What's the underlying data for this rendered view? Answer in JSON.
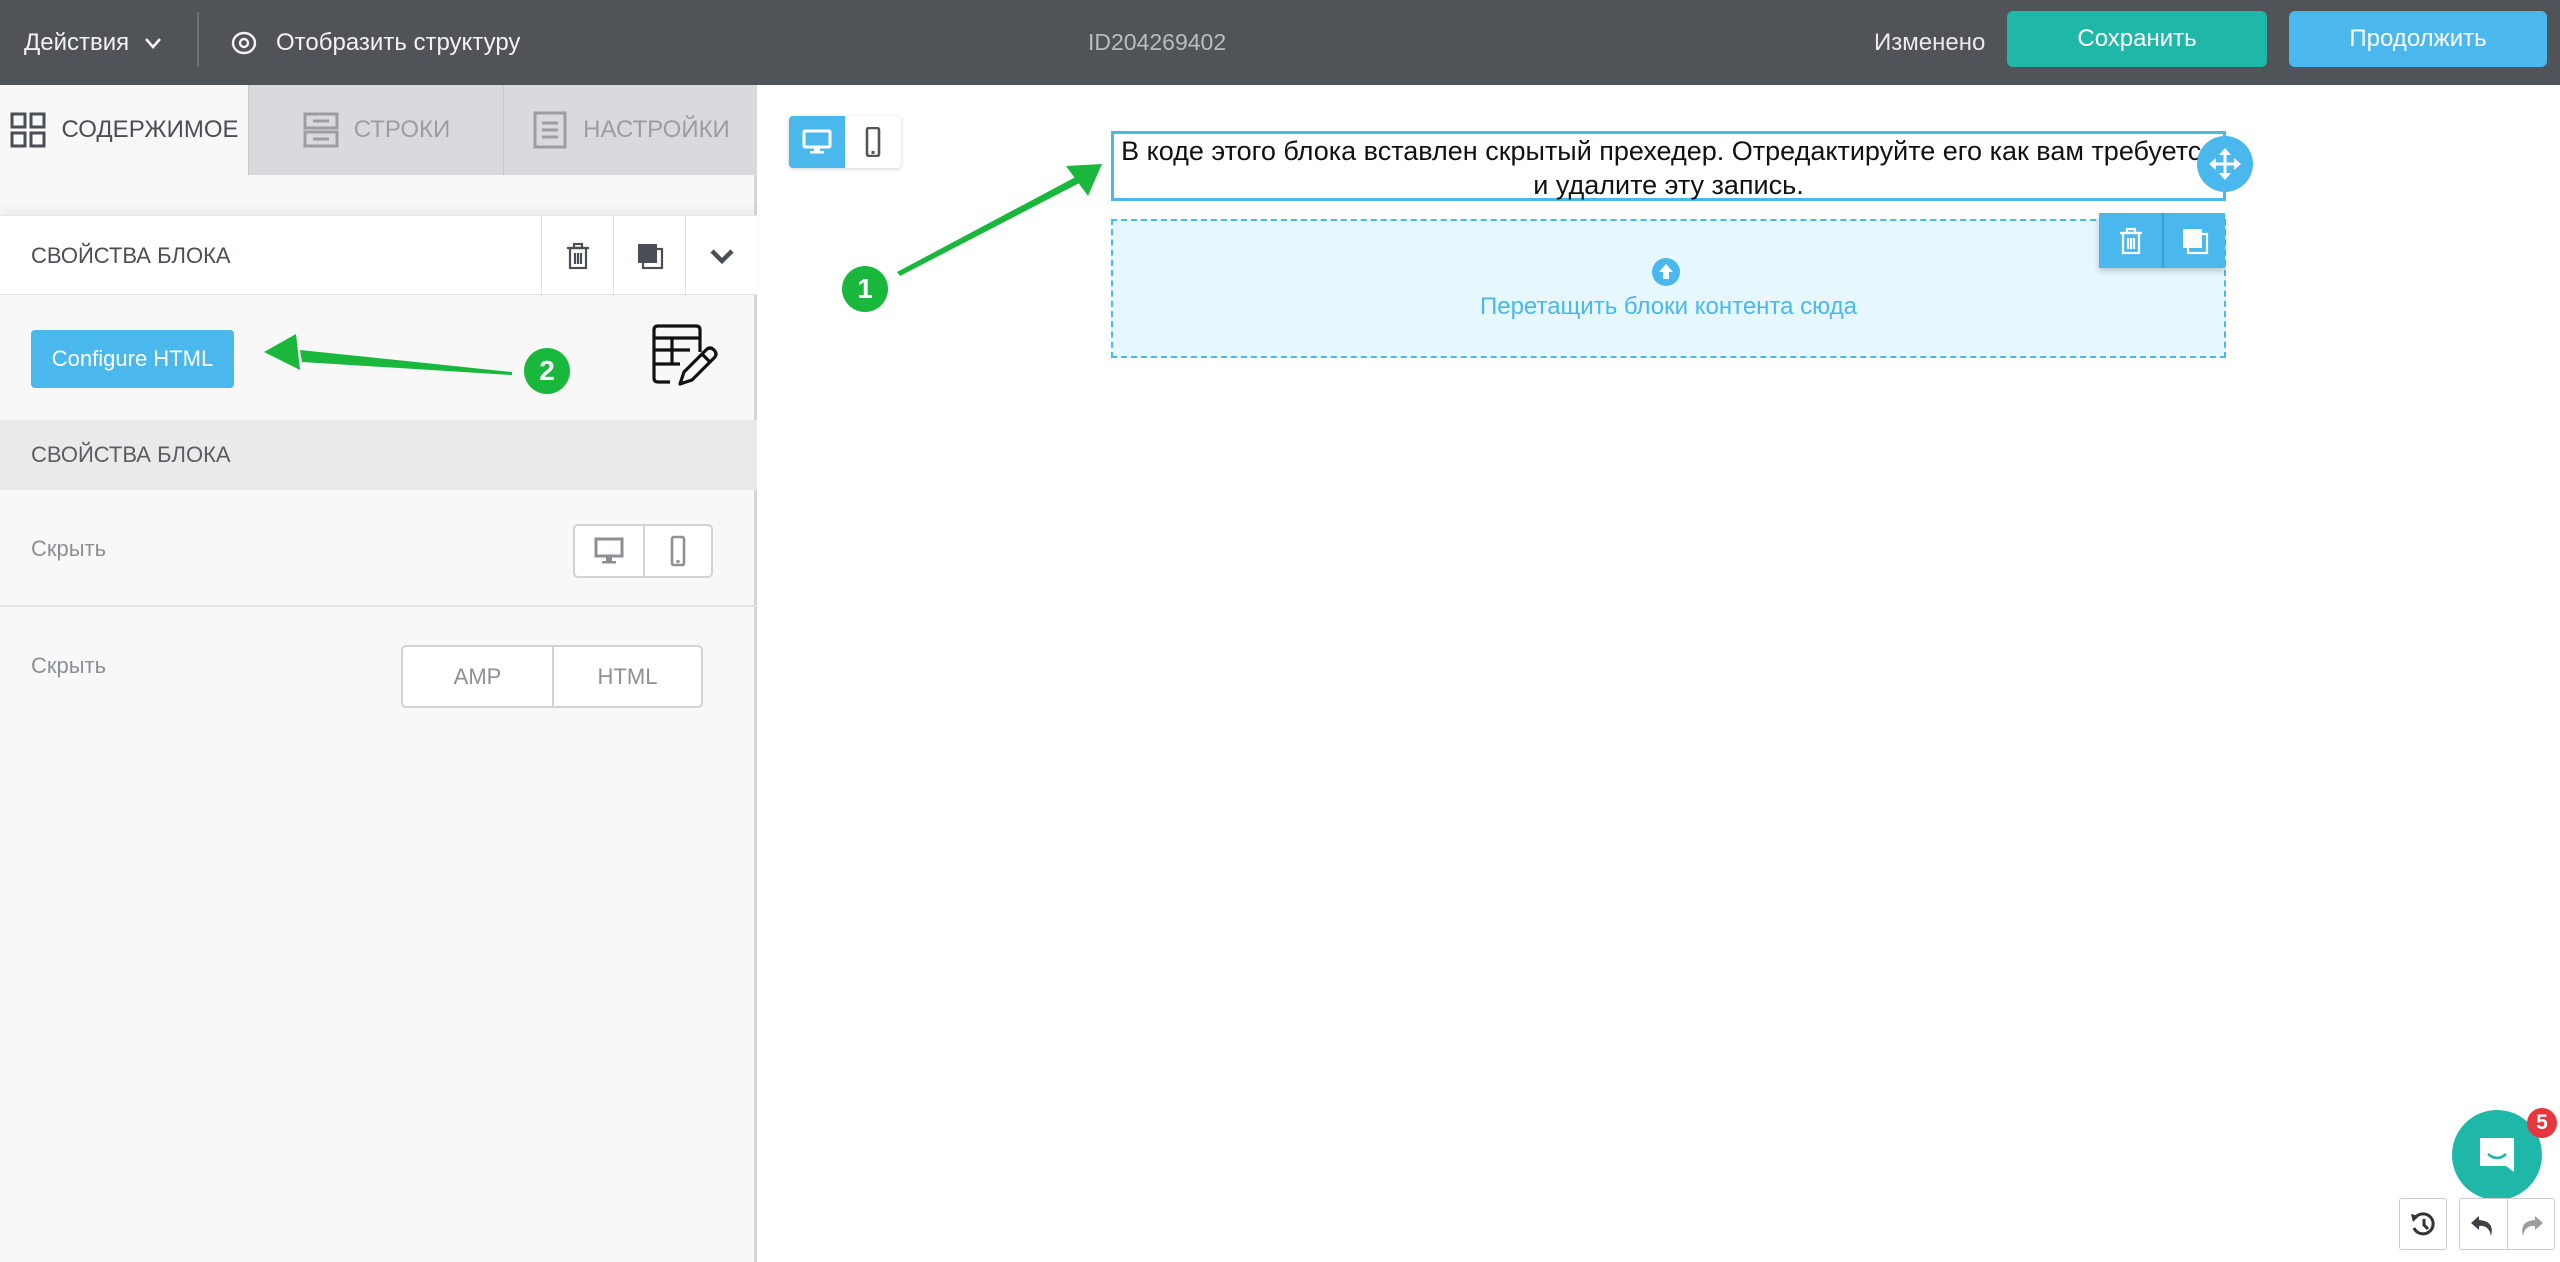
{
  "topbar": {
    "actions_label": "Действия",
    "structure_label": "Отобразить структуру",
    "document_id": "ID204269402",
    "status": "Изменено",
    "save_label": "Сохранить",
    "continue_label": "Продолжить"
  },
  "sidebar": {
    "tabs": [
      {
        "label": "СОДЕРЖИМОЕ",
        "icon": "grid-icon",
        "active": true
      },
      {
        "label": "СТРОКИ",
        "icon": "rows-icon",
        "active": false
      },
      {
        "label": "НАСТРОЙКИ",
        "icon": "settings-doc-icon",
        "active": false
      }
    ],
    "panel_title": "СВОЙСТВА БЛОКА",
    "configure_label": "Configure HTML",
    "section_title": "СВОЙСТВА БЛОКА",
    "hide_device": {
      "label": "Скрыть",
      "options": [
        "desktop-icon",
        "mobile-icon"
      ]
    },
    "hide_format": {
      "label": "Скрыть",
      "options": [
        "AMP",
        "HTML"
      ]
    }
  },
  "canvas": {
    "device_toggle": {
      "active": "desktop"
    },
    "text_block": "В коде этого блока вставлен скрытый прехедер. Отредактируйте его как вам требуется и удалите эту запись.",
    "drop_zone_text": "Перетащить блоки контента сюда"
  },
  "annotations": [
    "1",
    "2"
  ],
  "chat": {
    "badge_count": "5"
  },
  "colors": {
    "topbar": "#505459",
    "save": "#1fb7a8",
    "accent": "#4ab8ec",
    "annotation": "#19b73c",
    "badge": "#e8363f"
  }
}
